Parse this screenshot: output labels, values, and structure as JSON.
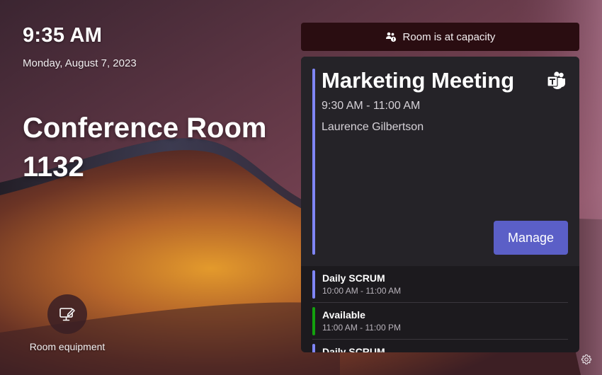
{
  "clock": {
    "time": "9:35 AM",
    "date": "Monday, August 7, 2023"
  },
  "room": {
    "name": "Conference Room 1132"
  },
  "equipment": {
    "label": "Room equipment",
    "icon": "monitor-edit-icon"
  },
  "banner": {
    "text": "Room is at capacity",
    "icon": "people-alert-icon"
  },
  "current_meeting": {
    "title": "Marketing Meeting",
    "time": "9:30 AM - 11:00 AM",
    "organizer": "Laurence Gilbertson",
    "platform_icon": "teams-icon",
    "manage_label": "Manage",
    "accent_color": "#7f85f5"
  },
  "agenda": [
    {
      "title": "Daily SCRUM",
      "time": "10:00 AM - 11:00 AM",
      "color": "#7f85f5"
    },
    {
      "title": "Available",
      "time": "11:00 AM - 11:00 PM",
      "color": "#13a10e"
    },
    {
      "title": "Daily SCRUM",
      "time": "",
      "color": "#7f85f5"
    }
  ],
  "settings": {
    "icon": "gear-icon"
  },
  "colors": {
    "accent": "#5b5fc7",
    "banner_bg": "#2a0d11",
    "panel_bg": "#1c1a1e"
  }
}
